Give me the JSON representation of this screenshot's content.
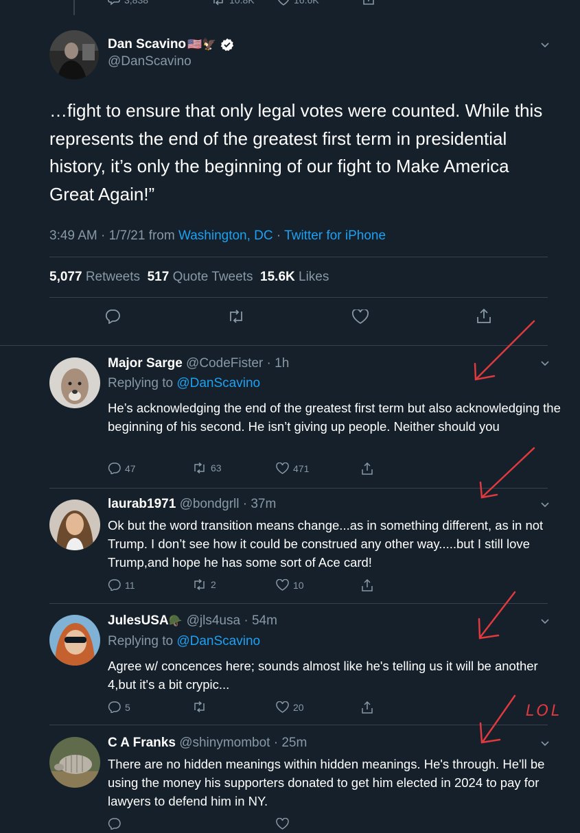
{
  "prev_tweet_stats": {
    "replies": "3,838",
    "retweets": "10.8K",
    "likes": "16.6K"
  },
  "main_tweet": {
    "name": "Dan Scavino",
    "name_emoji": "🇺🇸🦅",
    "handle": "@DanScavino",
    "text": "…fight to ensure that only legal votes were counted. While this represents the end of the greatest first term in presidential history, it’s only the beginning of our fight to Make America Great Again!”",
    "time": "3:49 AM · 1/7/21 from",
    "location": "Washington, DC",
    "sep": "·",
    "source": "Twitter for iPhone",
    "retweets_count": "5,077",
    "retweets_label": "Retweets",
    "quotes_count": "517",
    "quotes_label": "Quote Tweets",
    "likes_count": "15.6K",
    "likes_label": "Likes"
  },
  "replies": [
    {
      "name": "Major Sarge",
      "handle": "@CodeFister · 1h",
      "replying_prefix": "Replying to",
      "replying_handle": "@DanScavino",
      "text": "He’s acknowledging the end of the greatest first term but also acknowledging the beginning of his second. He isn’t giving up people. Neither should you",
      "replies": "47",
      "retweets": "63",
      "likes": "471"
    },
    {
      "name": "laurab1971",
      "handle": "@bondgrll · 37m",
      "text": "Ok but the word transition means change...as in something different, as in not Trump. I don’t see how it could be construed any other way.....but I still love Trump,and hope he has some sort of Ace card!",
      "replies": "11",
      "retweets": "2",
      "likes": "10"
    },
    {
      "name": "JulesUSA",
      "name_emoji": "🪖",
      "handle": "@jls4usa · 54m",
      "replying_prefix": "Replying to",
      "replying_handle": "@DanScavino",
      "text": "Agree w/ concences here; sounds almost like he's telling us it will be another 4,but it's a bit crypic...",
      "replies": "5",
      "retweets": "",
      "likes": "20"
    },
    {
      "name": "C A Franks",
      "handle": "@shinymombot · 25m",
      "text": "There are no hidden meanings within hidden meanings. He's through. He'll be using the money his supporters donated to get him elected in 2024 to pay for lawyers to defend him in NY."
    }
  ],
  "annotation_text": "LOL",
  "colors": {
    "background": "#15202b",
    "muted": "#8899a6",
    "link": "#1da1f2",
    "divider": "#38444d",
    "annotation": "#e0393e"
  }
}
